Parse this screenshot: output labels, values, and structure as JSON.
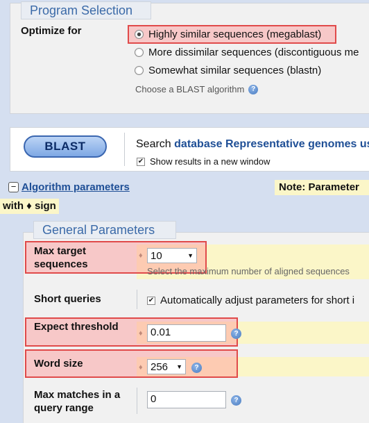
{
  "program_selection": {
    "legend": "Program Selection",
    "optimize_label": "Optimize for",
    "options": [
      {
        "label": "Highly similar sequences (megablast)",
        "checked": true
      },
      {
        "label": "More dissimilar sequences (discontiguous me",
        "checked": false
      },
      {
        "label": "Somewhat similar sequences (blastn)",
        "checked": false
      }
    ],
    "hint": "Choose a BLAST algorithm"
  },
  "blast": {
    "button_label": "BLAST",
    "search_prefix": "Search",
    "search_db": "database Representative genomes",
    "search_suffix": "us",
    "new_window_label": "Show results in a new window"
  },
  "algorithm": {
    "toggle_symbol": "−",
    "link_label": "Algorithm parameters",
    "note_label": "Note: Parameter",
    "with_sign": "with ♦ sign"
  },
  "general": {
    "legend": "General Parameters",
    "max_target": {
      "label_line1": "Max target",
      "label_line2": "sequences",
      "value": "10",
      "hint": "Select the maximum number of aligned sequences"
    },
    "short_queries": {
      "label": "Short queries",
      "checkbox_label": "Automatically adjust parameters for short i"
    },
    "expect": {
      "label": "Expect threshold",
      "value": "0.01"
    },
    "word_size": {
      "label": "Word size",
      "value": "256"
    },
    "max_matches": {
      "label_line1": "Max matches in a",
      "label_line2": "query range",
      "value": "0"
    }
  },
  "icons": {
    "diamond": "♦",
    "help": "?",
    "check": "✔"
  },
  "colors": {
    "highlight": "#e04a4a",
    "link": "#1f4f96",
    "legend_text": "#3b6aa8",
    "note_bg": "#fbf6c8"
  }
}
